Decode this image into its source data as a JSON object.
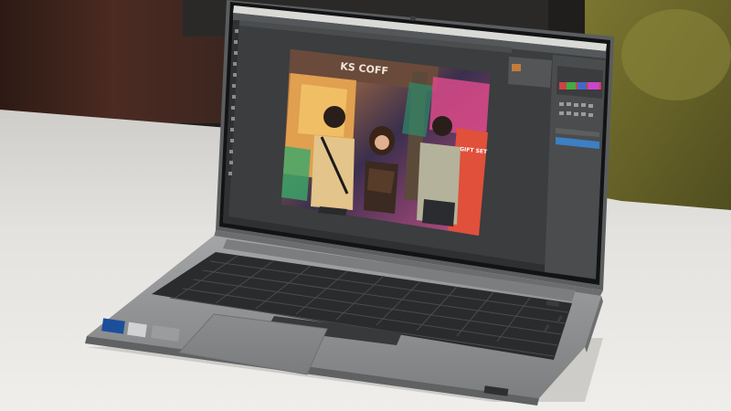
{
  "photo": {
    "sign_text": "KS COFF",
    "side_sign_text": "GIFT SET"
  },
  "colors": {
    "desk": "#e6e4e0",
    "wall_left": "#4b2b22",
    "chair_green": "#6f6b2a",
    "laptop_body": "#8d8f91",
    "keyboard": "#2a2b2d",
    "ps_background": "#3b3d3e",
    "ps_panel": "#4a4c4e",
    "ps_accent_blue": "#3d7fc3"
  },
  "icons": [
    "camera-icon",
    "intel-sticker-icon"
  ]
}
